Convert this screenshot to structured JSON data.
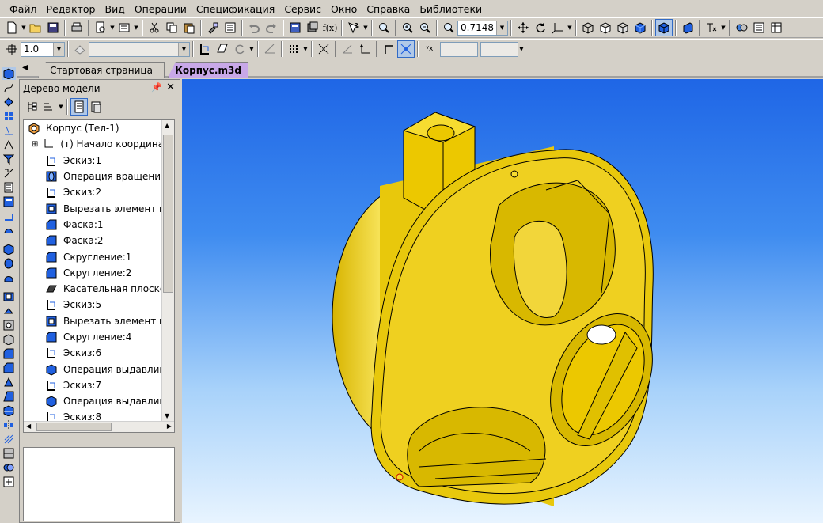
{
  "menu": [
    "Файл",
    "Редактор",
    "Вид",
    "Операции",
    "Спецификация",
    "Сервис",
    "Окно",
    "Справка",
    "Библиотеки"
  ],
  "toolbar": {
    "zoom_value": "0.7148"
  },
  "toolbar2": {
    "scale_value": "1.0",
    "style_value": "",
    "field1": "",
    "field2": ""
  },
  "tabs": [
    {
      "label": "Стартовая страница",
      "active": false
    },
    {
      "label": "Корпус.m3d",
      "active": true
    }
  ],
  "panel": {
    "title": "Дерево модели"
  },
  "tree": {
    "root": "Корпус (Тел-1)",
    "items": [
      {
        "label": "(т) Начало координат",
        "icon": "axes-icon"
      },
      {
        "label": "Эскиз:1",
        "icon": "sketch-icon"
      },
      {
        "label": "Операция вращения:",
        "icon": "revolve-icon"
      },
      {
        "label": "Эскиз:2",
        "icon": "sketch-icon"
      },
      {
        "label": "Вырезать элемент вр",
        "icon": "cut-revolve-icon"
      },
      {
        "label": "Фаска:1",
        "icon": "chamfer-icon"
      },
      {
        "label": "Фаска:2",
        "icon": "chamfer-icon"
      },
      {
        "label": "Скругление:1",
        "icon": "fillet-icon"
      },
      {
        "label": "Скругление:2",
        "icon": "fillet-icon"
      },
      {
        "label": "Касательная плоскос",
        "icon": "plane-icon"
      },
      {
        "label": "Эскиз:5",
        "icon": "sketch-icon"
      },
      {
        "label": "Вырезать элемент вы",
        "icon": "cut-extrude-icon"
      },
      {
        "label": "Скругление:4",
        "icon": "fillet-icon"
      },
      {
        "label": "Эскиз:6",
        "icon": "sketch-icon"
      },
      {
        "label": "Операция выдавлива",
        "icon": "extrude-icon"
      },
      {
        "label": "Эскиз:7",
        "icon": "sketch-icon"
      },
      {
        "label": "Операция выдавлива",
        "icon": "extrude-icon"
      },
      {
        "label": "Эскиз:8",
        "icon": "sketch-icon"
      }
    ]
  },
  "colors": {
    "part": "#e8c80c",
    "part_dark": "#b89a00",
    "viewport_top": "#1f66e6",
    "viewport_bottom": "#e8f4ff"
  }
}
